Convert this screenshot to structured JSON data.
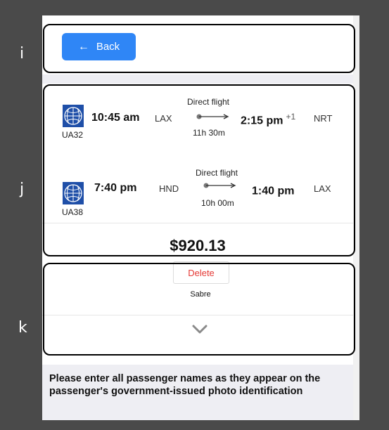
{
  "back_button": {
    "label": "Back"
  },
  "flights": [
    {
      "flight_number": "UA32",
      "depart_time": "10:45 am",
      "depart_airport": "LAX",
      "flight_type": "Direct flight",
      "duration": "11h 30m",
      "arrive_time": "2:15 pm",
      "day_offset": "+1",
      "arrive_airport": "NRT"
    },
    {
      "flight_number": "UA38",
      "depart_time": "7:40 pm",
      "depart_airport": "HND",
      "flight_type": "Direct flight",
      "duration": "10h 00m",
      "arrive_time": "1:40 pm",
      "day_offset": "",
      "arrive_airport": "LAX"
    }
  ],
  "price": "$920.13",
  "delete_button": {
    "label": "Delete"
  },
  "provider": "Sabre",
  "notice": "Please enter all passenger names as they appear on the passenger's government-issued photo identification",
  "region_labels": {
    "i": "i",
    "j": "j",
    "k": "k"
  },
  "colors": {
    "accent": "#2f86f6",
    "delete": "#e53935",
    "background": "#4a4a4a"
  },
  "icons": {
    "back": "arrow-left-icon",
    "expand": "chevron-down-icon",
    "airline": "united-globe-logo"
  }
}
